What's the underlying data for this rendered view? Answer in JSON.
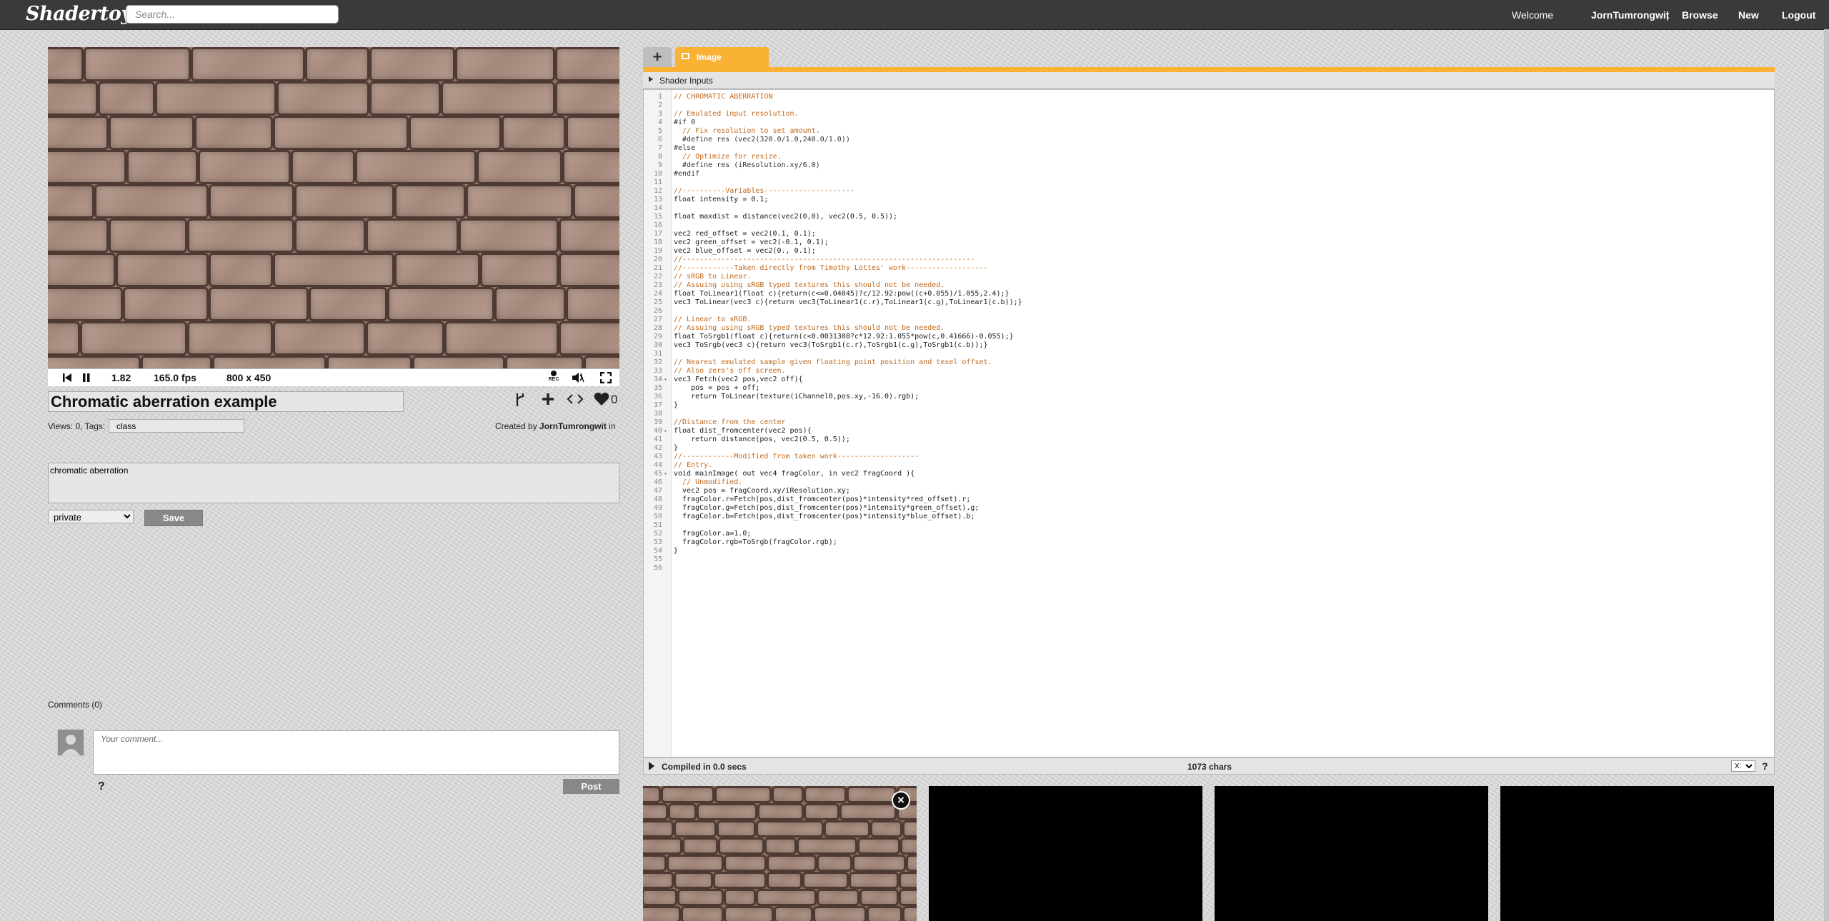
{
  "header": {
    "logo": "Shadertoy",
    "search_placeholder": "Search...",
    "welcome": "Welcome",
    "username": "JornTumrongwit",
    "separator": "|",
    "nav": [
      "Browse",
      "New",
      "Logout"
    ]
  },
  "player": {
    "time": "1.82",
    "fps": "165.0 fps",
    "resolution": "800 x 450",
    "rec_label": "REC"
  },
  "shader": {
    "title": "Chromatic aberration example",
    "likes": "0",
    "views_tags_label": "Views: 0, Tags:",
    "tags": "class",
    "created_by_label": "Created by",
    "author": "JornTumrongwit",
    "created_in": "in",
    "description": "chromatic aberration",
    "privacy": "private",
    "save_label": "Save"
  },
  "comments": {
    "label": "Comments (0)",
    "placeholder": "Your comment...",
    "help": "?",
    "post_label": "Post"
  },
  "editor": {
    "add_tab": "+",
    "active_tab": "Image",
    "shader_inputs_label": "Shader Inputs",
    "compiled": "Compiled in 0.0 secs",
    "chars": "1073 chars",
    "font_size_option": "X:",
    "help": "?",
    "code_lines": [
      "// CHROMATIC ABERRATION",
      "",
      "// Emulated input resolution.",
      "#if 0",
      "  // Fix resolution to set amount.",
      "  #define res (vec2(320.0/1.0,240.0/1.0))",
      "#else",
      "  // Optimize for resize.",
      "  #define res (iResolution.xy/6.0)",
      "#endif",
      "",
      "//----------Variables---------------------",
      "float intensity = 0.1;",
      "",
      "float maxdist = distance(vec2(0,0), vec2(0.5, 0.5));",
      "",
      "vec2 red_offset = vec2(0.1, 0.1);",
      "vec2 green_offset = vec2(-0.1, 0.1);",
      "vec2 blue_offset = vec2(0., 0.1);",
      "//--------------------------------------------------------------------",
      "//------------Taken directly from Timothy Lottes' work-------------------",
      "// sRGB to Linear.",
      "// Assuing using sRGB typed textures this should not be needed.",
      "float ToLinear1(float c){return(c<=0.04045)?c/12.92:pow((c+0.055)/1.055,2.4);}",
      "vec3 ToLinear(vec3 c){return vec3(ToLinear1(c.r),ToLinear1(c.g),ToLinear1(c.b));}",
      "",
      "// Linear to sRGB.",
      "// Assuing using sRGB typed textures this should not be needed.",
      "float ToSrgb1(float c){return(c<0.0031308?c*12.92:1.055*pow(c,0.41666)-0.055);}",
      "vec3 ToSrgb(vec3 c){return vec3(ToSrgb1(c.r),ToSrgb1(c.g),ToSrgb1(c.b));}",
      "",
      "// Nearest emulated sample given floating point position and texel offset.",
      "// Also zero's off screen.",
      "vec3 Fetch(vec2 pos,vec2 off){",
      "    pos = pos + off;",
      "    return ToLinear(texture(iChannel0,pos.xy,-16.0).rgb);",
      "}",
      "",
      "//Distance from the center",
      "float dist_fromcenter(vec2 pos){",
      "    return distance(pos, vec2(0.5, 0.5));",
      "}",
      "//------------Modified from taken work-------------------",
      "// Entry.",
      "void mainImage( out vec4 fragColor, in vec2 fragCoord ){",
      "  // Unmodified.",
      "  vec2 pos = fragCoord.xy/iResolution.xy;",
      "  fragColor.r=Fetch(pos,dist_fromcenter(pos)*intensity*red_offset).r;",
      "  fragColor.g=Fetch(pos,dist_fromcenter(pos)*intensity*green_offset).g;",
      "  fragColor.b=Fetch(pos,dist_fromcenter(pos)*intensity*blue_offset).b;",
      "",
      "  fragColor.a=1.0;",
      "  fragColor.rgb=ToSrgb(fragColor.rgb);",
      "}",
      "",
      ""
    ],
    "fold_lines": [
      34,
      40,
      45
    ]
  },
  "channels": {
    "close": "×"
  },
  "colors": {
    "topbar": "#3a3a3a",
    "accent": "#f9b233",
    "comment": "#c0691e"
  }
}
